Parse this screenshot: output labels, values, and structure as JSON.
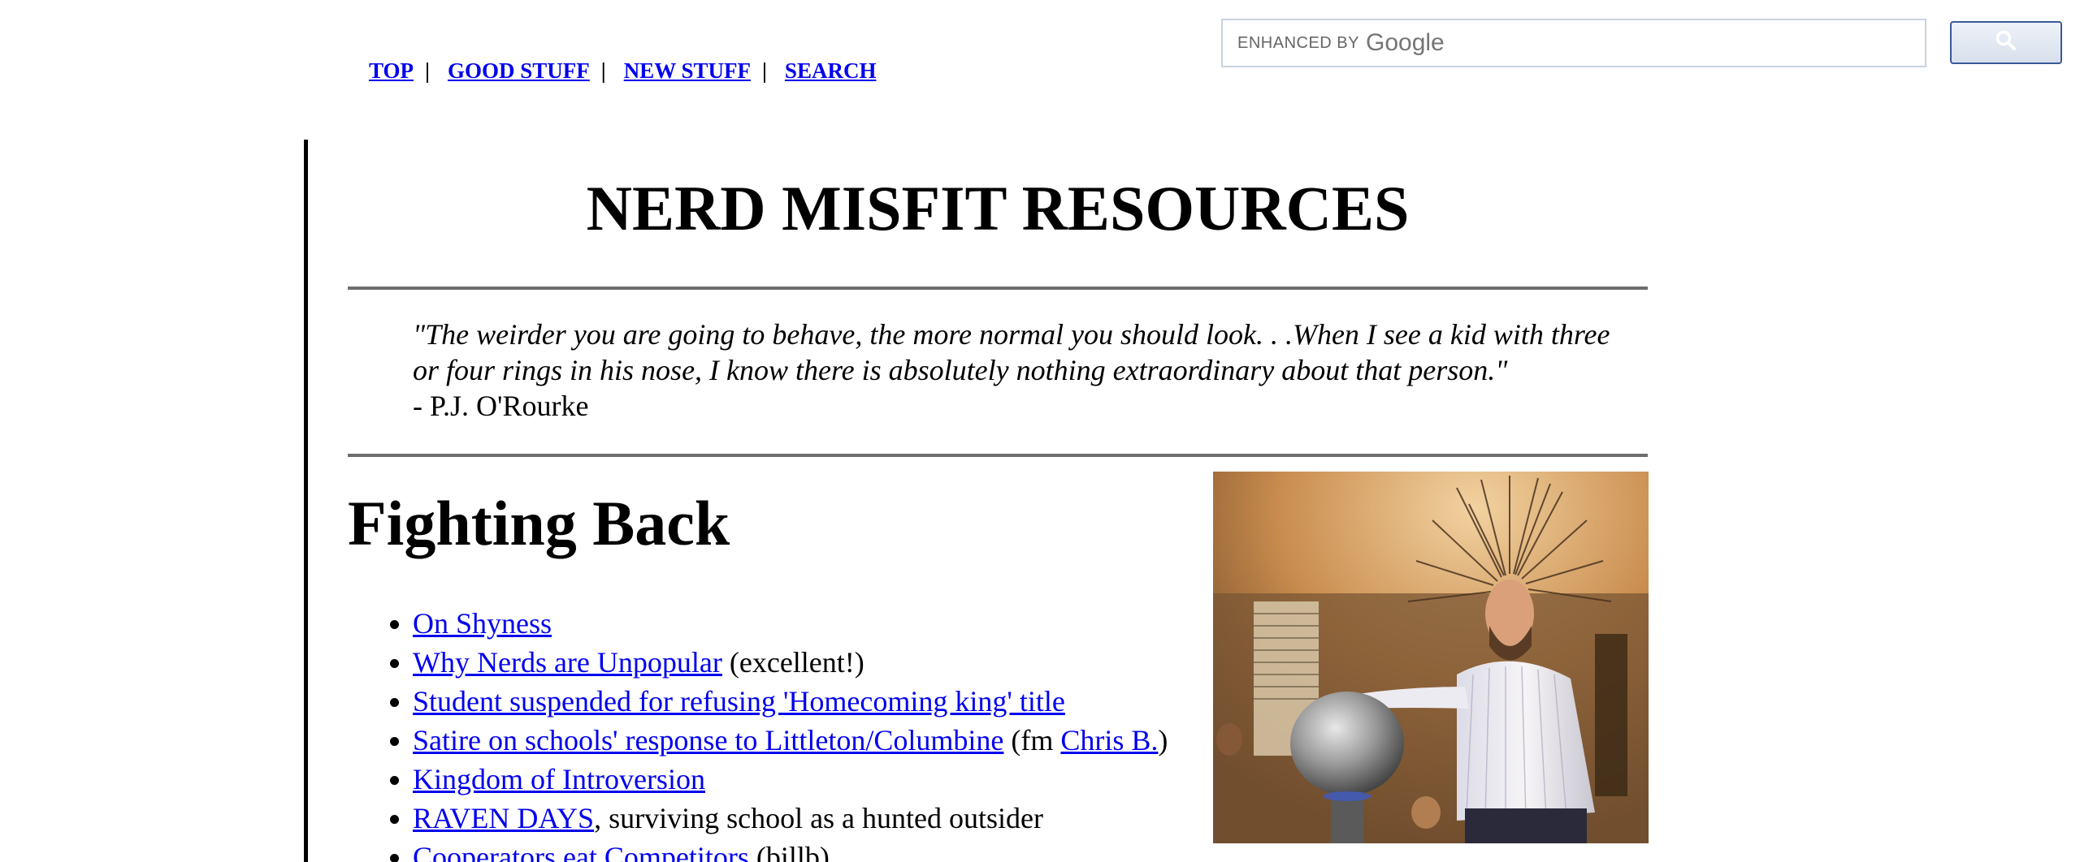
{
  "nav": {
    "items": [
      {
        "label": "TOP"
      },
      {
        "label": "GOOD STUFF"
      },
      {
        "label": "NEW STUFF"
      },
      {
        "label": "SEARCH"
      }
    ],
    "separator": "|"
  },
  "search": {
    "enhanced_by": "ENHANCED BY",
    "brand": "Google",
    "value": "",
    "placeholder": "",
    "button_icon": "search-icon"
  },
  "page": {
    "title": "NERD MISFIT RESOURCES",
    "quote_text": "\"The weirder you are going to behave, the more normal you should look. . .When I see a kid with three or four rings in his nose, I know there is absolutely nothing extraordinary about that person.\"",
    "quote_author": "- P.J. O'Rourke",
    "section_heading": "Fighting Back"
  },
  "links": [
    {
      "link": "On Shyness",
      "after": ""
    },
    {
      "link": "Why Nerds are Unpopular",
      "after": " (excellent!)"
    },
    {
      "link": "Student suspended for refusing 'Homecoming king' title",
      "after": ""
    },
    {
      "link": "Satire on schools' response to Littleton/Columbine",
      "mid": " (fm ",
      "link2": "Chris B.",
      "after": ")"
    },
    {
      "link": "Kingdom of Introversion",
      "after": ""
    },
    {
      "link": "RAVEN DAYS",
      "after": ", surviving school as a hunted outsider"
    },
    {
      "link": "Cooperators eat Competitors",
      "after": " (billb)"
    }
  ],
  "colors": {
    "link": "#0000ee",
    "rule": "#6e6e6e",
    "search_border": "#c9d3e0",
    "button_border": "#3b5998"
  }
}
